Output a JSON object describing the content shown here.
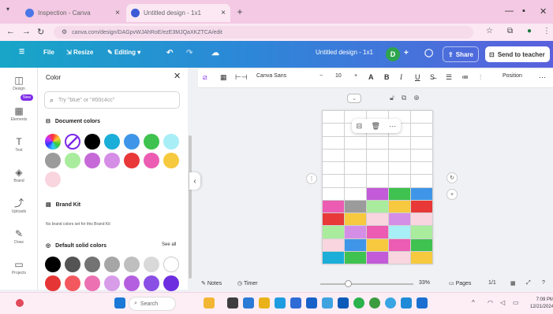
{
  "browser": {
    "tabs": [
      {
        "label": "Inspection - Canva",
        "favicon_color": "#4a76e8"
      },
      {
        "label": "Untitled design - 1x1",
        "favicon_color": "#3b5bd6"
      }
    ],
    "url": "canva.com/design/DAGpvWJAhRoE/ezE3MJQaXKZTCA/edit"
  },
  "header": {
    "menu_icon": "menu-icon",
    "file": "File",
    "resize": "Resize",
    "editing": "Editing",
    "doc_title": "Untitled design - 1x1",
    "avatar_initial": "D",
    "share": "Share",
    "send": "Send to teacher"
  },
  "rail": [
    {
      "icon": "design-icon",
      "label": "Design",
      "glyph": "◫"
    },
    {
      "icon": "elements-icon",
      "label": "Elements",
      "glyph": "▦"
    },
    {
      "icon": "text-icon",
      "label": "Text",
      "glyph": "T"
    },
    {
      "icon": "brand-icon",
      "label": "Brand",
      "glyph": "◈"
    },
    {
      "icon": "uploads-icon",
      "label": "Uploads",
      "glyph": "⤴"
    },
    {
      "icon": "draw-icon",
      "label": "Draw",
      "glyph": "✎"
    },
    {
      "icon": "projects-icon",
      "label": "Projects",
      "glyph": "▭"
    }
  ],
  "rail_new_badge": "New",
  "panel": {
    "title": "Color",
    "search_placeholder": "Try \"blue\" or \"#00c4cc\"",
    "document_colors_heading": "Document colors",
    "document_colors": [
      "#000000",
      "#1aaed8",
      "#3f96e8",
      "#3fc24f",
      "#a8eef7",
      "#9b9b9b",
      "#a9ec9d",
      "#c56ad8",
      "#d58ee6",
      "#e83838",
      "#ec5cb3",
      "#f6c93e",
      "#f9d5df"
    ],
    "brand_kit_heading": "Brand Kit",
    "brand_kit_text": "No brand colors set for this Brand Kit",
    "default_colors_heading": "Default solid colors",
    "see_all": "See all",
    "default_colors": [
      "#000000",
      "#545454",
      "#737373",
      "#a6a6a6",
      "#bfbfbf",
      "#d9d9d9",
      "#ffffff",
      "#e53535",
      "#f4585f",
      "#ec71b2",
      "#d79de8",
      "#b45fe0",
      "#8a4fe5",
      "#6d2ee0"
    ]
  },
  "toolbar": {
    "font": "Canva Sans",
    "font_size": "10",
    "position": "Position",
    "more": "⋯"
  },
  "canvas": {
    "cols": 5,
    "white_rows": 6,
    "color_rows": [
      [
        "#ffffff",
        "#ffffff",
        "#c35ad8",
        "#3fc24f",
        "#3f96e8"
      ],
      [
        "#ec5cb3",
        "#9b9b9b",
        "#a9ec9d",
        "#f6c93e",
        "#e83838"
      ],
      [
        "#e83838",
        "#f6c93e",
        "#f9d5df",
        "#d58ee6",
        "#f9d5df"
      ],
      [
        "#a9ec9d",
        "#d58ee6",
        "#ec5cb3",
        "#a8eef7",
        "#a9ec9d"
      ],
      [
        "#f9d5df",
        "#3f96e8",
        "#f6c93e",
        "#ec5cb3",
        "#3fc24f"
      ],
      [
        "#1aaed8",
        "#3fc24f",
        "#c35ad8",
        "#f9d5df",
        "#f6c93e"
      ]
    ]
  },
  "footer": {
    "notes": "Notes",
    "timer": "Timer",
    "zoom": "33%",
    "zoom_level": 0.3,
    "pages": "Pages",
    "page_count": "1/1"
  },
  "taskbar": {
    "search": "Search",
    "time": "7:09 PM",
    "date": "12/21/2024"
  }
}
